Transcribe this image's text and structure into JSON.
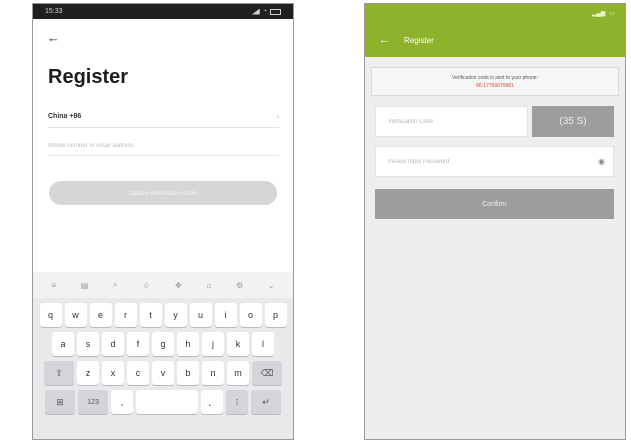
{
  "left_screen": {
    "status": {
      "time": "15:33",
      "signal_icon": "signal-icon",
      "battery_icon": "battery-icon"
    },
    "back_icon": "arrow-left-icon",
    "title": "Register",
    "country": {
      "value": "China +86",
      "chevron": "chevron-right-icon"
    },
    "account_input": {
      "placeholder": "Mobile number or email address",
      "value": ""
    },
    "obtain_button": {
      "label": "Obtain verification code"
    },
    "keyboard": {
      "toolbar": [
        "≡",
        "▤",
        "⌕",
        "☺",
        "✥",
        "⌂",
        "⚙",
        "⌄"
      ],
      "rows": [
        [
          "q",
          "w",
          "e",
          "r",
          "t",
          "y",
          "u",
          "i",
          "o",
          "p"
        ],
        [
          "a",
          "s",
          "d",
          "f",
          "g",
          "h",
          "j",
          "k",
          "l"
        ],
        [
          "⇧",
          "z",
          "x",
          "c",
          "v",
          "b",
          "n",
          "m",
          "⌫"
        ],
        [
          "⊞",
          "123",
          ",",
          "",
          "．",
          "⁝",
          "↵"
        ]
      ]
    }
  },
  "right_screen": {
    "header": {
      "back_icon": "arrow-left-icon",
      "title": "Register"
    },
    "notice": {
      "text": "Verification code is sent to your phone:",
      "phone": "86-17799679981"
    },
    "code_input": {
      "placeholder": "Verification Code",
      "value": ""
    },
    "countdown_button": {
      "label": "(35 S)"
    },
    "password_input": {
      "placeholder": "Please Input Password",
      "value": "",
      "eye_icon": "eye-icon"
    },
    "confirm_button": {
      "label": "Confirm"
    }
  },
  "colors": {
    "accent_green": "#8fb22c",
    "button_gray": "#9d9d9d",
    "disabled_button": "#d6d6d6",
    "phone_red": "#d64c3c"
  }
}
